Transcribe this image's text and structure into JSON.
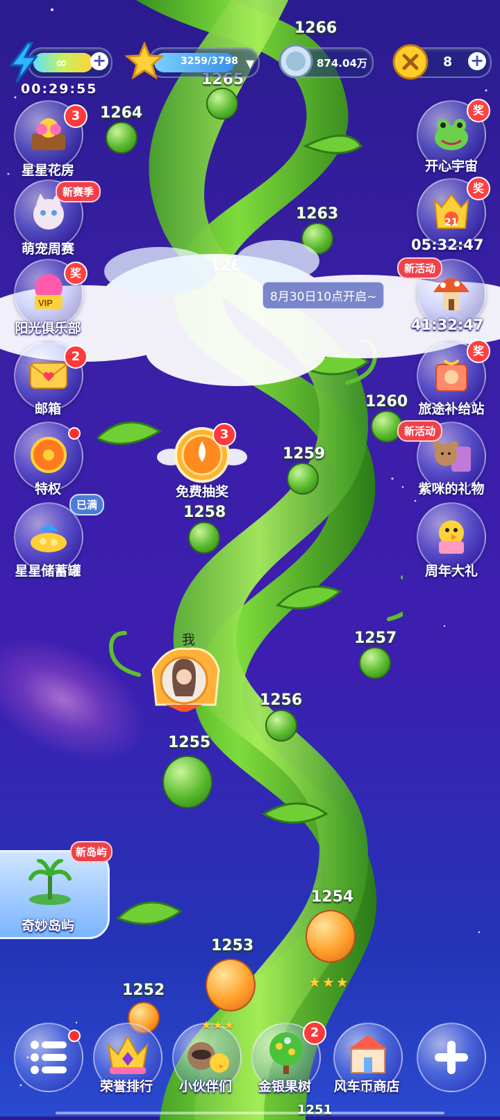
{
  "topbar": {
    "energy": {
      "value": "∞",
      "icon": "lightning-icon"
    },
    "stars": {
      "value": "3259/3798",
      "icon": "star-icon"
    },
    "coins": {
      "value": "874.04万",
      "icon": "silver-coin-icon"
    },
    "gold": {
      "value": "8",
      "icon": "gold-coin-icon"
    },
    "energy_timer": "00:29:55"
  },
  "left_menu": [
    {
      "label": "星星花房",
      "badge": "3"
    },
    {
      "label": "萌宠周赛",
      "tag": "新赛季"
    },
    {
      "label": "阳光俱乐部",
      "tag": "奖"
    },
    {
      "label": "邮箱",
      "badge": "2"
    },
    {
      "label": "特权"
    },
    {
      "label": "星星储蓄罐",
      "tag": "已满"
    },
    {
      "label": "奇妙岛屿",
      "tag": "新岛屿"
    }
  ],
  "right_menu": [
    {
      "label": "开心宇宙",
      "tag": "奖"
    },
    {
      "label": "05:32:47",
      "tag": "奖",
      "icon_text": "21"
    },
    {
      "label": "41:32:47",
      "tag": "新活动"
    },
    {
      "label": "旅途补给站",
      "tag": "奖"
    },
    {
      "label": "紫咪的礼物",
      "tag": "新活动"
    },
    {
      "label": "周年大礼"
    }
  ],
  "notice": "8月30日10点开启~",
  "free_draw": {
    "label": "免费抽奖",
    "badge": "3"
  },
  "player": {
    "marker": "我"
  },
  "levels": [
    "1266",
    "1265",
    "1264",
    "1263",
    "1262",
    "1260",
    "1259",
    "1258",
    "1257",
    "1256",
    "1255",
    "1254",
    "1253",
    "1252",
    "1251"
  ],
  "bottom_nav": [
    {
      "label": "",
      "icon": "menu-list-icon"
    },
    {
      "label": "荣誉排行",
      "icon": "crown-icon"
    },
    {
      "label": "小伙伴们",
      "icon": "friends-icon"
    },
    {
      "label": "金银果树",
      "icon": "fruit-tree-icon",
      "badge": "2"
    },
    {
      "label": "风车币商店",
      "icon": "shop-icon"
    },
    {
      "label": "",
      "icon": "plus-icon"
    }
  ]
}
